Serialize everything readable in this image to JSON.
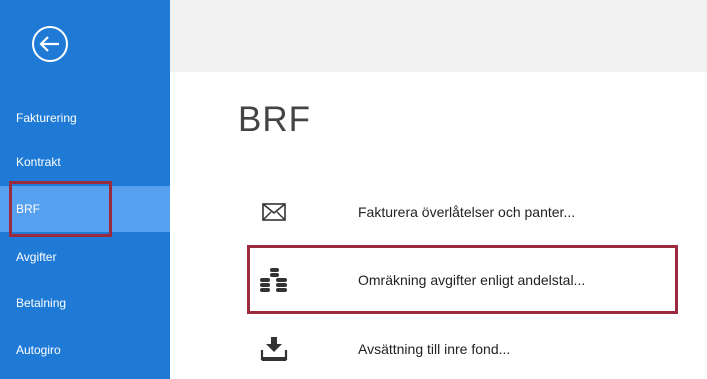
{
  "sidebar": {
    "back_icon": "back-arrow-circle-icon",
    "items": [
      {
        "label": "Fakturering",
        "selected": false
      },
      {
        "label": "Kontrakt",
        "selected": false
      },
      {
        "label": "BRF",
        "selected": true
      },
      {
        "label": "Avgifter",
        "selected": false
      },
      {
        "label": "Betalning",
        "selected": false
      },
      {
        "label": "Autogiro",
        "selected": false
      }
    ]
  },
  "main": {
    "title": "BRF",
    "actions": [
      {
        "label": "Fakturera överlåtelser och panter...",
        "icon": "envelope-icon"
      },
      {
        "label": "Omräkning avgifter enligt andelstal...",
        "icon": "coins-icon"
      },
      {
        "label": "Avsättning till inre fond...",
        "icon": "download-tray-icon"
      }
    ]
  },
  "colors": {
    "sidebar_bg": "#1f7ad6",
    "sidebar_selected": "#55a0ef",
    "highlight_border": "#9b2a3e",
    "topbar_bg": "#f1f1f1",
    "title_text": "#444444"
  }
}
